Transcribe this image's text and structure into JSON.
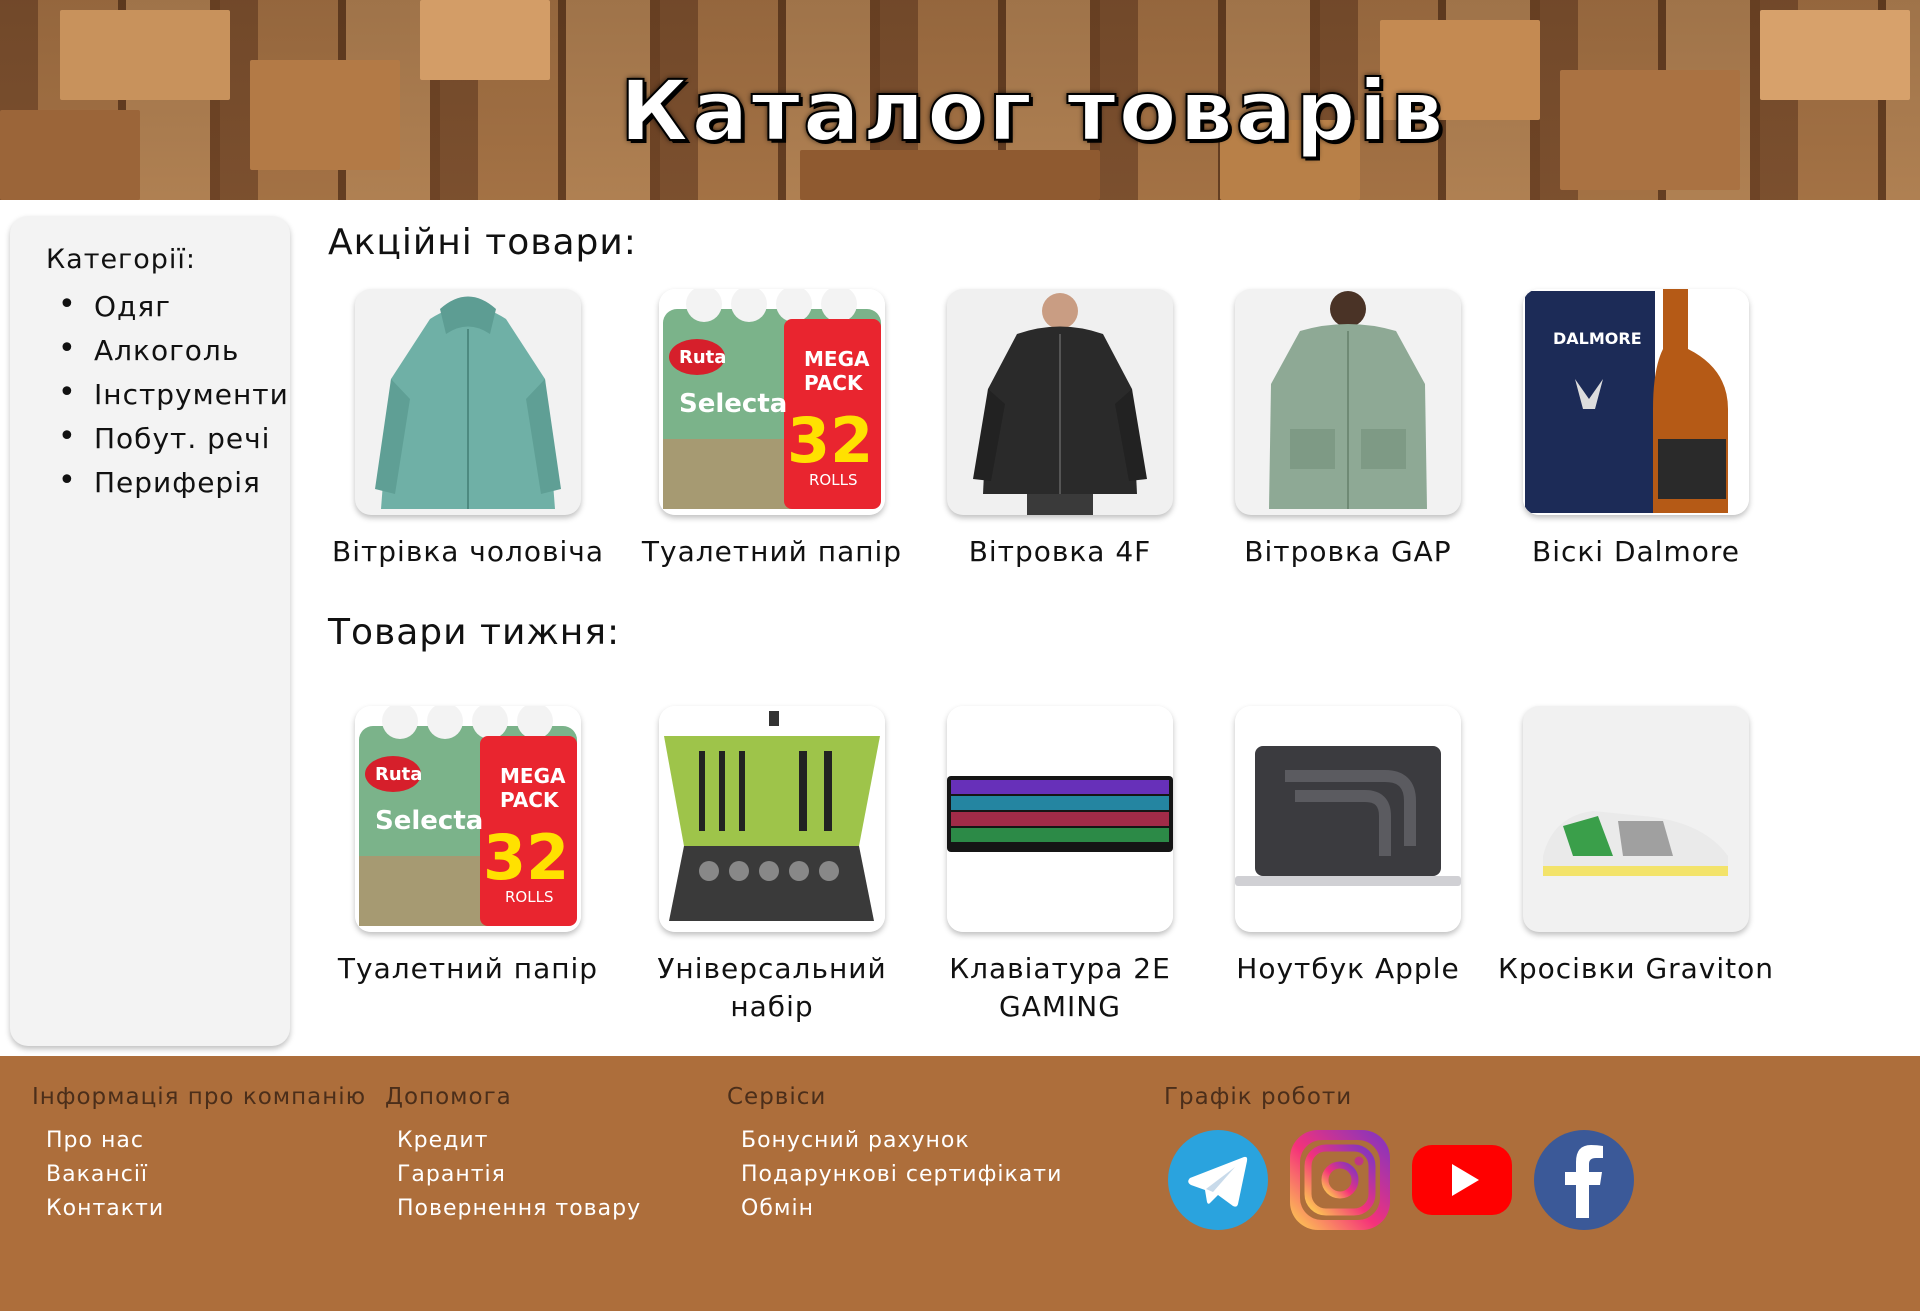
{
  "banner": {
    "title": "Каталог товарів"
  },
  "sidebar": {
    "title": "Категорії:",
    "items": [
      "Одяг",
      "Алкоголь",
      "Інструменти",
      "Побут. речі",
      "Периферія"
    ]
  },
  "sections": {
    "sale": {
      "title": "Акційні товари:",
      "products": [
        {
          "name": "Вітрівка чоловіча",
          "icon": "teal-jacket-image"
        },
        {
          "name": "Туалетний папір",
          "icon": "toilet-paper-image"
        },
        {
          "name": "Вітровка 4F",
          "icon": "black-jacket-image"
        },
        {
          "name": "Вітровка GAP",
          "icon": "green-jacket-image"
        },
        {
          "name": "Віскі Dalmore",
          "icon": "whisky-bottle-image"
        }
      ]
    },
    "week": {
      "title": "Товари тижня:",
      "products": [
        {
          "name": "Туалетний папір",
          "icon": "toilet-paper-image"
        },
        {
          "name": "Універсальний набір",
          "icon": "tool-kit-image"
        },
        {
          "name": "Клавіатура 2E GAMING",
          "icon": "keyboard-image"
        },
        {
          "name": "Ноутбук Apple",
          "icon": "laptop-image"
        },
        {
          "name": "Кросівки Graviton",
          "icon": "sneakers-image"
        }
      ]
    }
  },
  "product_images": {
    "ruta_brand": "Ruta",
    "ruta_sub": "Selecta",
    "ruta_mega": "MEGA",
    "ruta_pack": "PACK",
    "ruta_count": "32",
    "ruta_rolls": "ROLLS",
    "dalmore_brand": "DALMORE"
  },
  "footer": {
    "columns": [
      {
        "title": "Інформація про компанію",
        "links": [
          "Про нас",
          "Вакансії",
          "Контакти"
        ]
      },
      {
        "title": "Допомога",
        "links": [
          "Кредит",
          "Гарантія",
          "Повернення товару"
        ]
      },
      {
        "title": "Сервіси",
        "links": [
          "Бонусний рахунок",
          "Подарункові сертифікати",
          "Обмін"
        ]
      },
      {
        "title": "Графік роботи",
        "links": []
      }
    ],
    "social": [
      "telegram-icon",
      "instagram-icon",
      "youtube-icon",
      "facebook-icon"
    ]
  },
  "colors": {
    "footer_bg": "#ad6e3b",
    "sidebar_bg": "#f3f3f3",
    "telegram": "#2aa3de",
    "youtube": "#ff0000",
    "facebook": "#3b5998"
  }
}
